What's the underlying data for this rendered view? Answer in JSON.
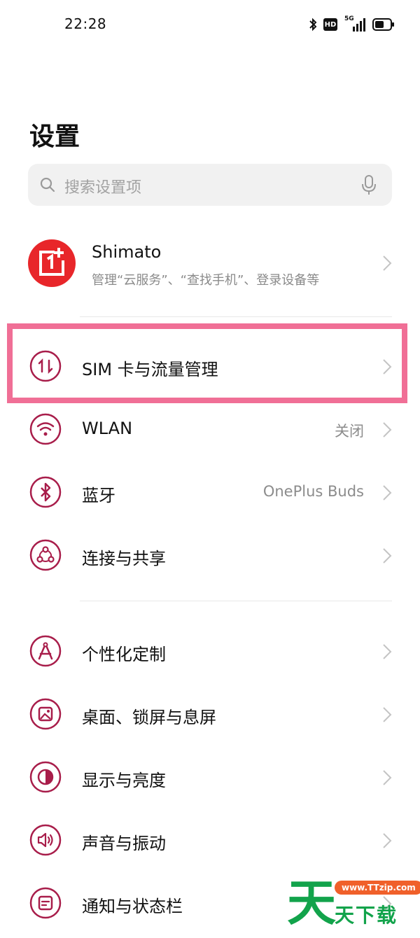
{
  "status_bar": {
    "time": "22:28",
    "icons": [
      "bluetooth-icon",
      "hd-icon",
      "5g-signal-icon",
      "battery-icon"
    ],
    "hd_text": "HD",
    "network_text": "5G"
  },
  "page": {
    "title": "设置"
  },
  "search": {
    "placeholder": "搜索设置项"
  },
  "account": {
    "name": "Shimato",
    "subtitle": "管理“云服务”、“查找手机”、登录设备等",
    "avatar_color": "#e8262a"
  },
  "highlight_color": "#f06f96",
  "accent_color": "#a81d4a",
  "items": [
    {
      "label": "SIM 卡与流量管理",
      "value": "",
      "icon": "data-transfer-icon"
    },
    {
      "label": "WLAN",
      "value": "关闭",
      "icon": "wifi-icon"
    },
    {
      "label": "蓝牙",
      "value": "OnePlus Buds",
      "icon": "bluetooth-icon"
    },
    {
      "label": "连接与共享",
      "value": "",
      "icon": "share-connection-icon"
    },
    {
      "label": "个性化定制",
      "value": "",
      "icon": "compass-personalize-icon"
    },
    {
      "label": "桌面、锁屏与息屏",
      "value": "",
      "icon": "wallpaper-icon"
    },
    {
      "label": "显示与亮度",
      "value": "",
      "icon": "brightness-icon"
    },
    {
      "label": "声音与振动",
      "value": "",
      "icon": "speaker-icon"
    },
    {
      "label": "通知与状态栏",
      "value": "",
      "icon": "notification-icon"
    }
  ],
  "watermark": {
    "big_char": "天",
    "url": "www.TTzip.com",
    "text": "天下载"
  }
}
